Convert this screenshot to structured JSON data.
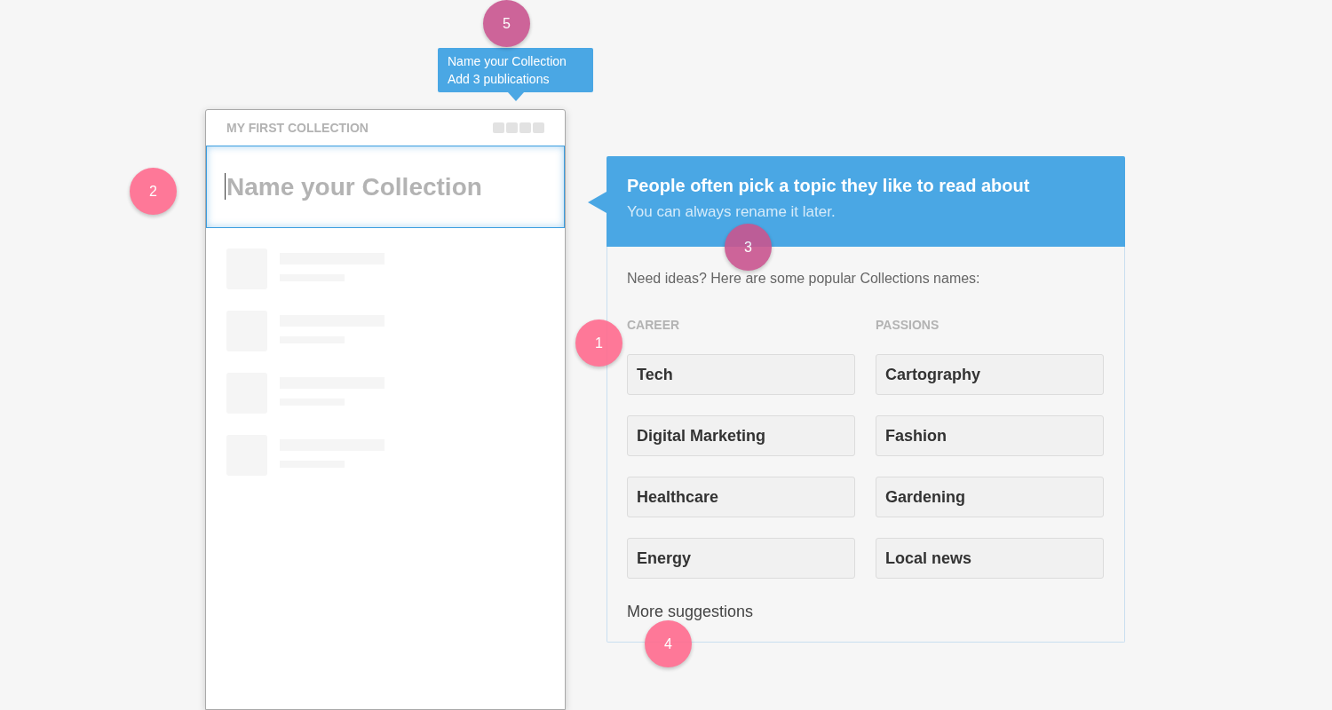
{
  "tooltip": {
    "lines": [
      "Name your Collection",
      "Add 3 publications"
    ]
  },
  "collection": {
    "title": "MY FIRST COLLECTION",
    "name_field": {
      "placeholder": "Name your Collection",
      "focused": true
    },
    "placeholder_rows": [
      {
        "kind": "placeholder"
      },
      {
        "kind": "placeholder"
      },
      {
        "kind": "placeholder"
      },
      {
        "kind": "placeholder"
      }
    ]
  },
  "tip": {
    "title": "People often pick a topic they like to read about",
    "subtitle": "You can always rename it later."
  },
  "suggestions": {
    "intro": "Need ideas? Here are some popular Collections names:",
    "columns": [
      {
        "heading": "CAREER",
        "items": [
          "Tech",
          "Digital Marketing",
          "Healthcare",
          "Energy"
        ]
      },
      {
        "heading": "PASSIONS",
        "items": [
          "Cartography",
          "Fashion",
          "Gardening",
          "Local news"
        ]
      }
    ],
    "more": "More suggestions"
  },
  "markers": [
    {
      "label": "1"
    },
    {
      "label": "2"
    },
    {
      "label": "3"
    },
    {
      "label": "4"
    },
    {
      "label": "5"
    }
  ]
}
